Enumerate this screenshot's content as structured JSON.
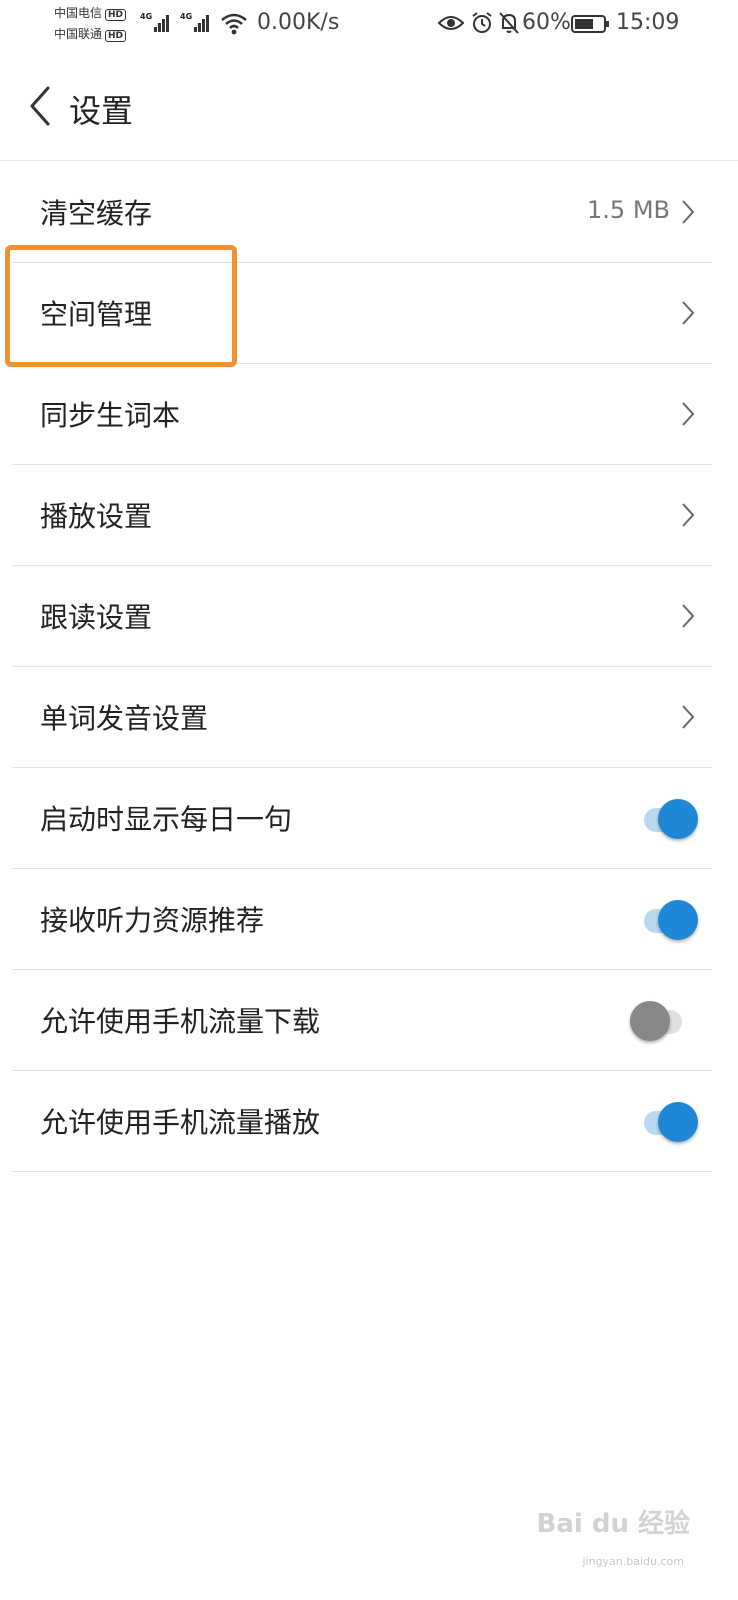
{
  "status_bar": {
    "carrier_1": "中国电信",
    "carrier_2": "中国联通",
    "hd_badge": "HD",
    "network_type": "4G",
    "net_speed": "0.00K/s",
    "battery": "60%",
    "time": "15:09",
    "icons": [
      "signal-icon",
      "wifi-icon",
      "eye-icon",
      "alarm-icon",
      "bell-off-icon",
      "battery-icon"
    ]
  },
  "header": {
    "title": "设置",
    "back_icon": "chevron-left-icon"
  },
  "settings": {
    "clear_cache": {
      "label": "清空缓存",
      "value": "1.5 MB"
    },
    "space_management": {
      "label": "空间管理"
    },
    "sync_vocab": {
      "label": "同步生词本"
    },
    "playback_settings": {
      "label": "播放设置"
    },
    "follow_read_settings": {
      "label": "跟读设置"
    },
    "word_pronunciation": {
      "label": "单词发音设置"
    },
    "daily_sentence": {
      "label": "启动时显示每日一句",
      "enabled": true
    },
    "listening_recommend": {
      "label": "接收听力资源推荐",
      "enabled": true
    },
    "mobile_download": {
      "label": "允许使用手机流量下载",
      "enabled": false
    },
    "mobile_playback": {
      "label": "允许使用手机流量播放",
      "enabled": true
    }
  },
  "colors": {
    "accent": "#1e88d6",
    "toggle_track_on": "#b9d9f0",
    "toggle_off": "#888888",
    "highlight": "#f39033"
  },
  "watermark": {
    "text": "Bai du 经验",
    "sub": "jingyan.baidu.com"
  }
}
